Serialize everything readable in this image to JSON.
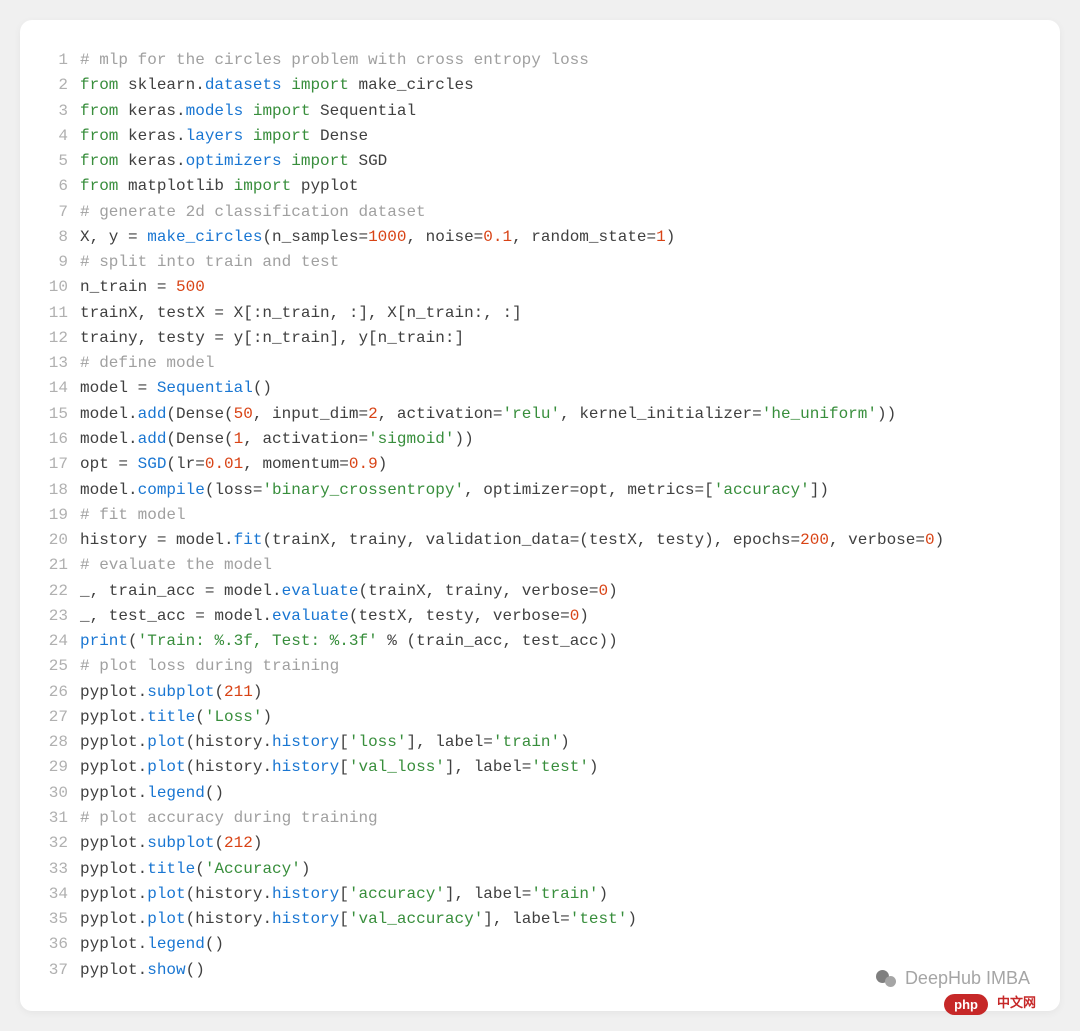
{
  "watermark": "DeepHub IMBA",
  "badge": "php",
  "badge_cn": "中文网",
  "lines": [
    {
      "no": "1",
      "tokens": [
        [
          "c",
          "# mlp for the circles problem with cross entropy loss"
        ]
      ]
    },
    {
      "no": "2",
      "tokens": [
        [
          "k",
          "from"
        ],
        [
          "n",
          " sklearn"
        ],
        [
          "p",
          "."
        ],
        [
          "na",
          "datasets"
        ],
        [
          "n",
          " "
        ],
        [
          "k",
          "import"
        ],
        [
          "n",
          " make_circles"
        ]
      ]
    },
    {
      "no": "3",
      "tokens": [
        [
          "k",
          "from"
        ],
        [
          "n",
          " keras"
        ],
        [
          "p",
          "."
        ],
        [
          "na",
          "models"
        ],
        [
          "n",
          " "
        ],
        [
          "k",
          "import"
        ],
        [
          "n",
          " Sequential"
        ]
      ]
    },
    {
      "no": "4",
      "tokens": [
        [
          "k",
          "from"
        ],
        [
          "n",
          " keras"
        ],
        [
          "p",
          "."
        ],
        [
          "na",
          "layers"
        ],
        [
          "n",
          " "
        ],
        [
          "k",
          "import"
        ],
        [
          "n",
          " Dense"
        ]
      ]
    },
    {
      "no": "5",
      "tokens": [
        [
          "k",
          "from"
        ],
        [
          "n",
          " keras"
        ],
        [
          "p",
          "."
        ],
        [
          "na",
          "optimizers"
        ],
        [
          "n",
          " "
        ],
        [
          "k",
          "import"
        ],
        [
          "n",
          " SGD"
        ]
      ]
    },
    {
      "no": "6",
      "tokens": [
        [
          "k",
          "from"
        ],
        [
          "n",
          " matplotlib "
        ],
        [
          "k",
          "import"
        ],
        [
          "n",
          " pyplot"
        ]
      ]
    },
    {
      "no": "7",
      "tokens": [
        [
          "c",
          "# generate 2d classification dataset"
        ]
      ]
    },
    {
      "no": "8",
      "tokens": [
        [
          "n",
          "X, y = "
        ],
        [
          "nf",
          "make_circles"
        ],
        [
          "p",
          "("
        ],
        [
          "n",
          "n_samples="
        ],
        [
          "mi",
          "1000"
        ],
        [
          "n",
          ", noise="
        ],
        [
          "mi",
          "0.1"
        ],
        [
          "n",
          ", random_state="
        ],
        [
          "mi",
          "1"
        ],
        [
          "p",
          ")"
        ]
      ]
    },
    {
      "no": "9",
      "tokens": [
        [
          "c",
          "# split into train and test"
        ]
      ]
    },
    {
      "no": "10",
      "tokens": [
        [
          "n",
          "n_train = "
        ],
        [
          "mi",
          "500"
        ]
      ]
    },
    {
      "no": "11",
      "tokens": [
        [
          "n",
          "trainX, testX = X[:n_train, :], X[n_train:, :]"
        ]
      ]
    },
    {
      "no": "12",
      "tokens": [
        [
          "n",
          "trainy, testy = y[:n_train], y[n_train:]"
        ]
      ]
    },
    {
      "no": "13",
      "tokens": [
        [
          "c",
          "# define model"
        ]
      ]
    },
    {
      "no": "14",
      "tokens": [
        [
          "n",
          "model = "
        ],
        [
          "nf",
          "Sequential"
        ],
        [
          "p",
          "()"
        ]
      ]
    },
    {
      "no": "15",
      "tokens": [
        [
          "n",
          "model."
        ],
        [
          "na",
          "add"
        ],
        [
          "p",
          "("
        ],
        [
          "n",
          "Dense("
        ],
        [
          "mi",
          "50"
        ],
        [
          "n",
          ", input_dim="
        ],
        [
          "mi",
          "2"
        ],
        [
          "n",
          ", activation="
        ],
        [
          "s",
          "'relu'"
        ],
        [
          "n",
          ", kernel_initializer="
        ],
        [
          "s",
          "'he_uniform'"
        ],
        [
          "p",
          "))"
        ]
      ]
    },
    {
      "no": "16",
      "tokens": [
        [
          "n",
          "model."
        ],
        [
          "na",
          "add"
        ],
        [
          "p",
          "("
        ],
        [
          "n",
          "Dense("
        ],
        [
          "mi",
          "1"
        ],
        [
          "n",
          ", activation="
        ],
        [
          "s",
          "'sigmoid'"
        ],
        [
          "p",
          "))"
        ]
      ]
    },
    {
      "no": "17",
      "tokens": [
        [
          "n",
          "opt = "
        ],
        [
          "nf",
          "SGD"
        ],
        [
          "p",
          "("
        ],
        [
          "n",
          "lr="
        ],
        [
          "mi",
          "0.01"
        ],
        [
          "n",
          ", momentum="
        ],
        [
          "mi",
          "0.9"
        ],
        [
          "p",
          ")"
        ]
      ]
    },
    {
      "no": "18",
      "tokens": [
        [
          "n",
          "model."
        ],
        [
          "na",
          "compile"
        ],
        [
          "p",
          "("
        ],
        [
          "n",
          "loss="
        ],
        [
          "s",
          "'binary_crossentropy'"
        ],
        [
          "n",
          ", optimizer=opt, metrics=["
        ],
        [
          "s",
          "'accuracy'"
        ],
        [
          "p",
          "])"
        ]
      ]
    },
    {
      "no": "19",
      "tokens": [
        [
          "c",
          "# fit model"
        ]
      ]
    },
    {
      "no": "20",
      "tokens": [
        [
          "n",
          "history = model."
        ],
        [
          "na",
          "fit"
        ],
        [
          "p",
          "("
        ],
        [
          "n",
          "trainX, trainy, validation_data=(testX, testy), epochs="
        ],
        [
          "mi",
          "200"
        ],
        [
          "n",
          ", verbose="
        ],
        [
          "mi",
          "0"
        ],
        [
          "p",
          ")"
        ]
      ]
    },
    {
      "no": "21",
      "tokens": [
        [
          "c",
          "# evaluate the model"
        ]
      ]
    },
    {
      "no": "22",
      "tokens": [
        [
          "n",
          "_, train_acc = model."
        ],
        [
          "na",
          "evaluate"
        ],
        [
          "p",
          "("
        ],
        [
          "n",
          "trainX, trainy, verbose="
        ],
        [
          "mi",
          "0"
        ],
        [
          "p",
          ")"
        ]
      ]
    },
    {
      "no": "23",
      "tokens": [
        [
          "n",
          "_, test_acc = model."
        ],
        [
          "na",
          "evaluate"
        ],
        [
          "p",
          "("
        ],
        [
          "n",
          "testX, testy, verbose="
        ],
        [
          "mi",
          "0"
        ],
        [
          "p",
          ")"
        ]
      ]
    },
    {
      "no": "24",
      "tokens": [
        [
          "nf",
          "print"
        ],
        [
          "p",
          "("
        ],
        [
          "s",
          "'Train: %.3f, Test: %.3f'"
        ],
        [
          "n",
          " % (train_acc, test_acc))"
        ]
      ]
    },
    {
      "no": "25",
      "tokens": [
        [
          "c",
          "# plot loss during training"
        ]
      ]
    },
    {
      "no": "26",
      "tokens": [
        [
          "n",
          "pyplot."
        ],
        [
          "na",
          "subplot"
        ],
        [
          "p",
          "("
        ],
        [
          "mi",
          "211"
        ],
        [
          "p",
          ")"
        ]
      ]
    },
    {
      "no": "27",
      "tokens": [
        [
          "n",
          "pyplot."
        ],
        [
          "na",
          "title"
        ],
        [
          "p",
          "("
        ],
        [
          "s",
          "'Loss'"
        ],
        [
          "p",
          ")"
        ]
      ]
    },
    {
      "no": "28",
      "tokens": [
        [
          "n",
          "pyplot."
        ],
        [
          "na",
          "plot"
        ],
        [
          "p",
          "("
        ],
        [
          "n",
          "history."
        ],
        [
          "na",
          "history"
        ],
        [
          "p",
          "["
        ],
        [
          "s",
          "'loss'"
        ],
        [
          "p",
          "], "
        ],
        [
          "n",
          "label="
        ],
        [
          "s",
          "'train'"
        ],
        [
          "p",
          ")"
        ]
      ]
    },
    {
      "no": "29",
      "tokens": [
        [
          "n",
          "pyplot."
        ],
        [
          "na",
          "plot"
        ],
        [
          "p",
          "("
        ],
        [
          "n",
          "history."
        ],
        [
          "na",
          "history"
        ],
        [
          "p",
          "["
        ],
        [
          "s",
          "'val_loss'"
        ],
        [
          "p",
          "], "
        ],
        [
          "n",
          "label="
        ],
        [
          "s",
          "'test'"
        ],
        [
          "p",
          ")"
        ]
      ]
    },
    {
      "no": "30",
      "tokens": [
        [
          "n",
          "pyplot."
        ],
        [
          "na",
          "legend"
        ],
        [
          "p",
          "()"
        ]
      ]
    },
    {
      "no": "31",
      "tokens": [
        [
          "c",
          "# plot accuracy during training"
        ]
      ]
    },
    {
      "no": "32",
      "tokens": [
        [
          "n",
          "pyplot."
        ],
        [
          "na",
          "subplot"
        ],
        [
          "p",
          "("
        ],
        [
          "mi",
          "212"
        ],
        [
          "p",
          ")"
        ]
      ]
    },
    {
      "no": "33",
      "tokens": [
        [
          "n",
          "pyplot."
        ],
        [
          "na",
          "title"
        ],
        [
          "p",
          "("
        ],
        [
          "s",
          "'Accuracy'"
        ],
        [
          "p",
          ")"
        ]
      ]
    },
    {
      "no": "34",
      "tokens": [
        [
          "n",
          "pyplot."
        ],
        [
          "na",
          "plot"
        ],
        [
          "p",
          "("
        ],
        [
          "n",
          "history."
        ],
        [
          "na",
          "history"
        ],
        [
          "p",
          "["
        ],
        [
          "s",
          "'accuracy'"
        ],
        [
          "p",
          "], "
        ],
        [
          "n",
          "label="
        ],
        [
          "s",
          "'train'"
        ],
        [
          "p",
          ")"
        ]
      ]
    },
    {
      "no": "35",
      "tokens": [
        [
          "n",
          "pyplot."
        ],
        [
          "na",
          "plot"
        ],
        [
          "p",
          "("
        ],
        [
          "n",
          "history."
        ],
        [
          "na",
          "history"
        ],
        [
          "p",
          "["
        ],
        [
          "s",
          "'val_accuracy'"
        ],
        [
          "p",
          "], "
        ],
        [
          "n",
          "label="
        ],
        [
          "s",
          "'test'"
        ],
        [
          "p",
          ")"
        ]
      ]
    },
    {
      "no": "36",
      "tokens": [
        [
          "n",
          "pyplot."
        ],
        [
          "na",
          "legend"
        ],
        [
          "p",
          "()"
        ]
      ]
    },
    {
      "no": "37",
      "tokens": [
        [
          "n",
          "pyplot."
        ],
        [
          "na",
          "show"
        ],
        [
          "p",
          "()"
        ]
      ]
    }
  ]
}
